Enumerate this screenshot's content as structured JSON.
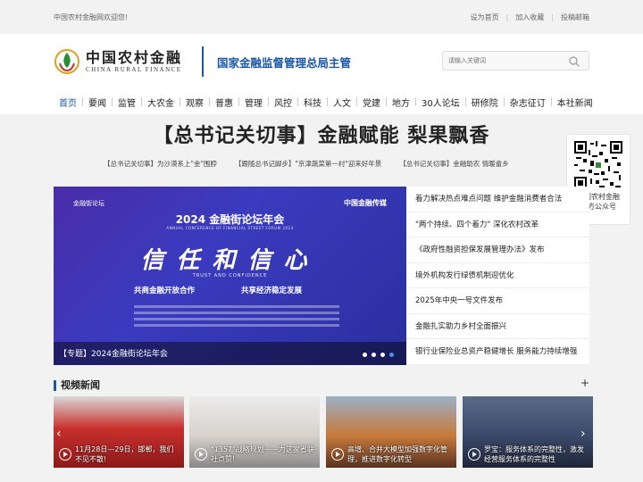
{
  "topbar": {
    "welcome": "中国农村金融网欢迎您!",
    "links": [
      "设为首页",
      "加入收藏",
      "投稿邮箱"
    ]
  },
  "header": {
    "logo_cn": "中国农村金融",
    "logo_en": "CHINA RURAL FINANCE",
    "slogan": "国家金融监督管理总局主管",
    "search_placeholder": "请输入关键词"
  },
  "nav": {
    "items": [
      "首页",
      "要闻",
      "监管",
      "大农金",
      "观察",
      "普惠",
      "管理",
      "风控",
      "科技",
      "人文",
      "党建",
      "地方",
      "30人论坛",
      "研修院",
      "杂志征订",
      "本社新闻"
    ]
  },
  "hero": {
    "title": "【总书记关切事】金融赋能 梨果飘香",
    "sub_links": [
      "【总书记关切事】为沙漠系上\"金\"围脖",
      "【跟随总书记脚步】\"京津蔬菜第一村\"迎来好年景",
      "【总书记关切事】金融助农 情暖畲乡"
    ]
  },
  "qr": {
    "label_line1": "中国农村金融",
    "label_line2": "官方公众号"
  },
  "banner": {
    "top_left": "金融街论坛",
    "top_right": "中国金融传媒",
    "conf_title": "2024 金融街论坛年会",
    "conf_en": "ANNUAL CONFERENCE OF FINANCIAL STREET FORUM 2024",
    "big_text": "信任和信心",
    "trust": "TRUST AND CONFIDENCE",
    "line1": "共商金融开放合作",
    "line2": "共享经济稳定发展",
    "caption": "【专题】2024金融街论坛年会",
    "dots": 4,
    "active_dot": 3
  },
  "news": [
    "着力解决热点难点问题 维护金融消费者合法",
    "\"两个持续、四个着力\" 深化农村改革",
    "《政府性融资担保发展管理办法》发布",
    "境外机构发行绿债机制迎优化",
    "2025年中央一号文件发布",
    "金融扎实助力乡村全面振兴",
    "银行业保险业总资产稳健增长 服务能力持续增强"
  ],
  "video": {
    "title": "视频新闻",
    "more": "+",
    "cards": [
      {
        "caption": "11月28日—29日，邯郸，我们不见不散!"
      },
      {
        "caption": "\"1357\"战略规划——为这家省联社点赞!"
      },
      {
        "caption": "高增、合并大模型加强数字化管理，推进数字化转型"
      },
      {
        "caption": "罗宝：服务体系的完整性，激发经营服务体系的完整性"
      }
    ]
  }
}
